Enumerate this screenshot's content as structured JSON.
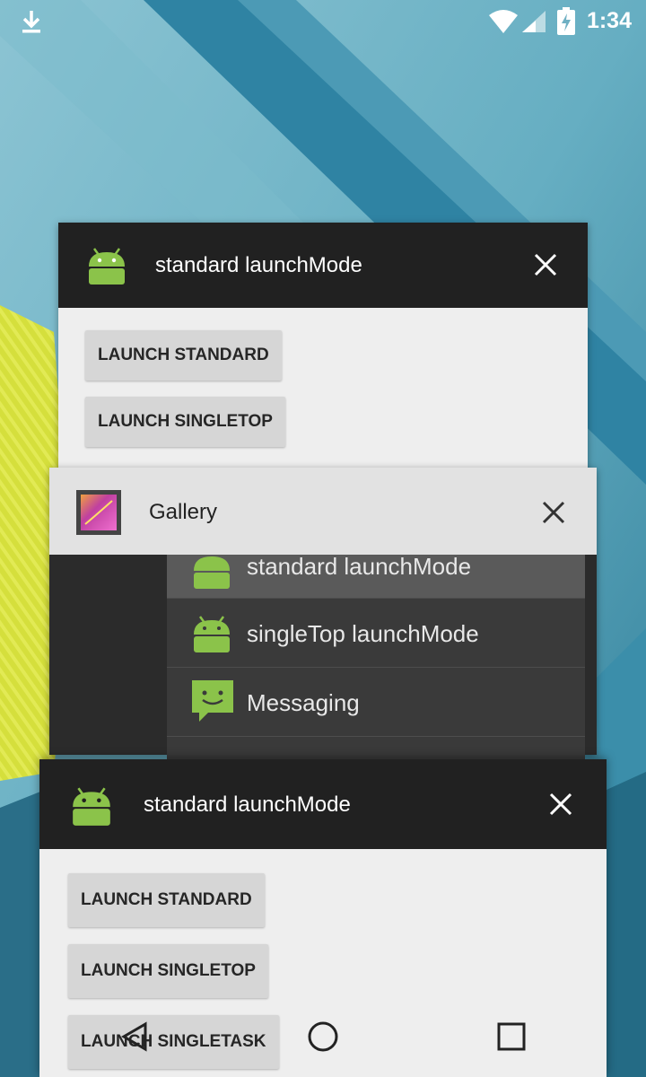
{
  "status_bar": {
    "time": "1:34",
    "icons": [
      "download-icon",
      "wifi-icon",
      "cell-signal-icon",
      "battery-charging-icon"
    ]
  },
  "recents": {
    "cards": [
      {
        "title": "standard launchMode",
        "icon": "android-robot-icon",
        "buttons": [
          "LAUNCH STANDARD",
          "LAUNCH SINGLETOP"
        ]
      },
      {
        "title": "Gallery",
        "icon": "gallery-icon",
        "chooser_items": [
          {
            "label": "standard launchMode",
            "icon": "android-robot-icon"
          },
          {
            "label": "singleTop launchMode",
            "icon": "android-robot-icon"
          },
          {
            "label": "Messaging",
            "icon": "messaging-icon"
          }
        ]
      },
      {
        "title": "standard launchMode",
        "icon": "android-robot-icon",
        "buttons": [
          "LAUNCH STANDARD",
          "LAUNCH SINGLETOP",
          "LAUNCH SINGLETASK"
        ]
      }
    ]
  },
  "nav_bar": {
    "buttons": [
      "back-icon",
      "home-icon",
      "recents-icon"
    ]
  },
  "colors": {
    "card_header_dark": "#212121",
    "card_header_light": "#e2e2e2",
    "card_body": "#eeeeee",
    "android_green": "#8bc34a",
    "chooser_bg": "#3a3a3a"
  }
}
